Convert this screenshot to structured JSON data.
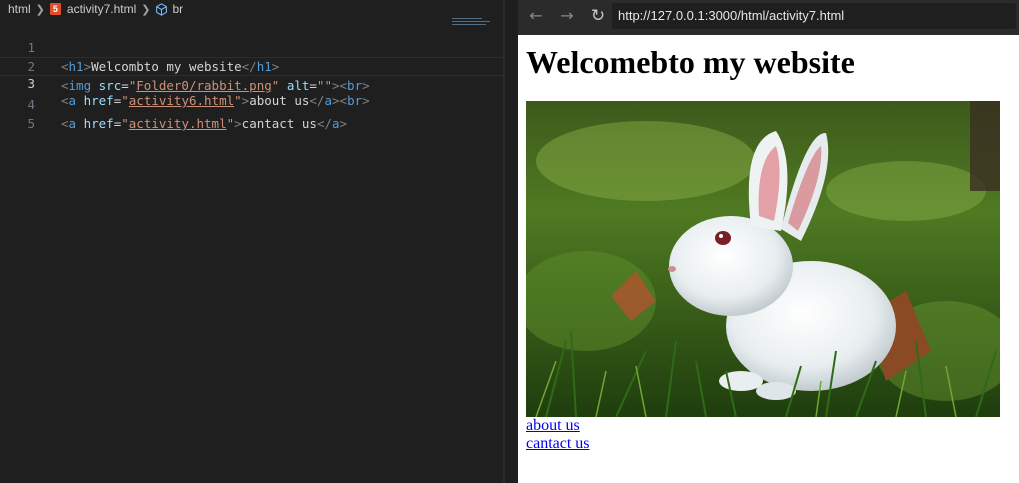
{
  "editor": {
    "breadcrumb": {
      "root": "html",
      "file": "activity7.html",
      "symbol": "br"
    },
    "lines": [
      {
        "number": "1"
      },
      {
        "number": "2"
      },
      {
        "number": "3"
      },
      {
        "number": "4"
      },
      {
        "number": "5"
      }
    ],
    "code": {
      "l1_open": "h1",
      "l1_text": "Welcombto my website",
      "l1_close": "h1",
      "l2_tag": "img",
      "l2_attr_src": "src",
      "l2_src": "Folder0/rabbit.png",
      "l2_attr_alt": "alt",
      "l2_alt": "",
      "l2_br": "br",
      "l3_tag": "a",
      "l3_attr": "href",
      "l3_href": "activity6.html",
      "l3_text": "about us",
      "l3_close": "a",
      "l3_br": "br",
      "l4_tag": "a",
      "l4_attr": "href",
      "l4_href": "activity.html",
      "l4_text": "cantact us",
      "l4_close": "a"
    }
  },
  "browser": {
    "back_icon": "back-arrow-icon",
    "forward_icon": "forward-arrow-icon",
    "reload_icon": "reload-icon",
    "url": "http://127.0.0.1:3000/html/activity7.html",
    "page": {
      "heading": "Welcomebto my website",
      "image_description": "rabbit photo",
      "link1": "about us",
      "link2": "cantact us"
    }
  },
  "colors": {
    "tag": "#569cd6",
    "attribute": "#9cdcfe",
    "string": "#ce9178",
    "link": "#0000ee",
    "editor_bg": "#1f1f1f"
  }
}
